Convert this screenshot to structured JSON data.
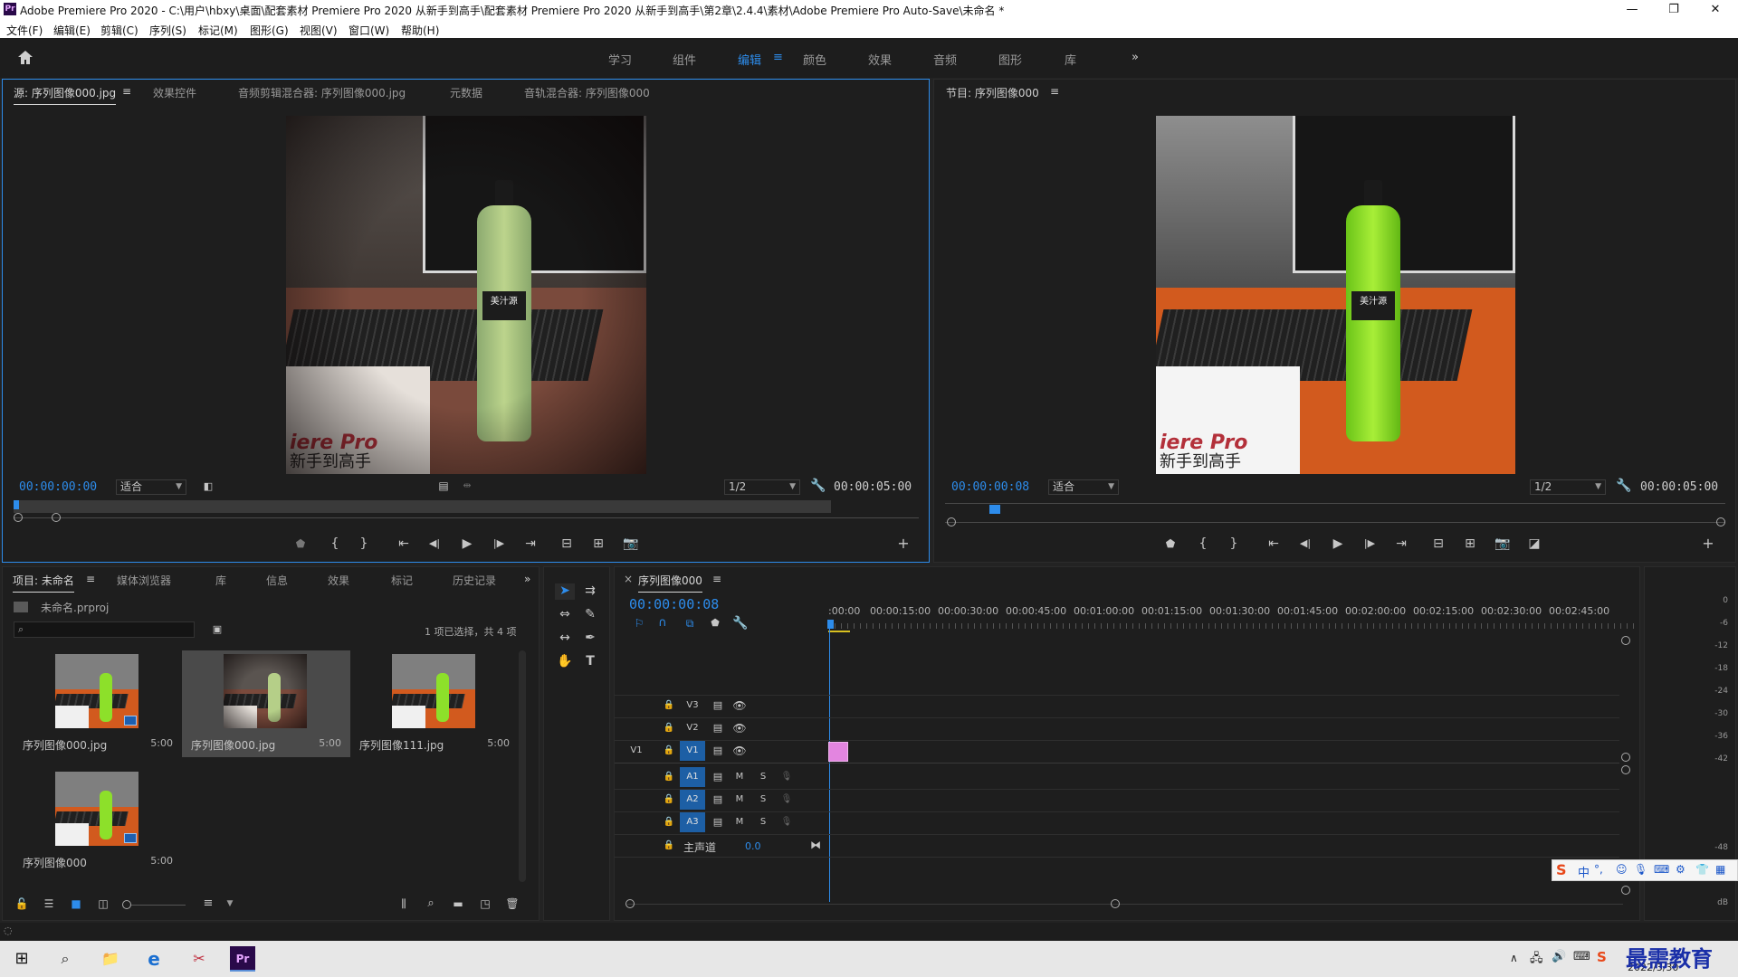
{
  "titlebar": {
    "logo": "Pr",
    "title": "Adobe Premiere Pro 2020 - C:\\用户\\hbxy\\桌面\\配套素材 Premiere Pro 2020 从新手到高手\\配套素材 Premiere Pro 2020 从新手到高手\\第2章\\2.4.4\\素材\\Adobe Premiere Pro Auto-Save\\未命名 *",
    "minimize": "—",
    "maximize": "❐",
    "close": "✕"
  },
  "menubar": [
    "文件(F)",
    "编辑(E)",
    "剪辑(C)",
    "序列(S)",
    "标记(M)",
    "图形(G)",
    "视图(V)",
    "窗口(W)",
    "帮助(H)"
  ],
  "workspaces": {
    "tabs": [
      "学习",
      "组件",
      "编辑",
      "颜色",
      "效果",
      "音频",
      "图形",
      "库"
    ],
    "active": "编辑",
    "more": "»"
  },
  "source_panel": {
    "tabs": [
      "源: 序列图像000.jpg",
      "效果控件",
      "音频剪辑混合器: 序列图像000.jpg",
      "元数据",
      "音轨混合器: 序列图像000"
    ],
    "timecode": "00:00:00:00",
    "fit": "适合",
    "resolution": "1/2",
    "duration": "00:00:05:00"
  },
  "program_panel": {
    "title": "节目: 序列图像000",
    "timecode": "00:00:00:08",
    "fit": "适合",
    "resolution": "1/2",
    "duration": "00:00:05:00"
  },
  "frame": {
    "book_title": "iere Pro",
    "book_sub": "新手到高手",
    "bottle_label": "美汁源"
  },
  "project_panel": {
    "tabs": [
      "项目: 未命名",
      "媒体浏览器",
      "库",
      "信息",
      "效果",
      "标记",
      "历史记录"
    ],
    "project_file": "未命名.prproj",
    "selection_status": "1 项已选择，共 4 项",
    "search_placeholder": "",
    "items": [
      {
        "name": "序列图像000.jpg",
        "duration": "5:00"
      },
      {
        "name": "序列图像000.jpg",
        "duration": "5:00"
      },
      {
        "name": "序列图像111.jpg",
        "duration": "5:00"
      },
      {
        "name": "序列图像000",
        "duration": "5:00"
      }
    ]
  },
  "timeline": {
    "title": "序列图像000",
    "timecode": "00:00:00:08",
    "ruler": [
      ":00:00",
      "00:00:15:00",
      "00:00:30:00",
      "00:00:45:00",
      "00:01:00:00",
      "00:01:15:00",
      "00:01:30:00",
      "00:01:45:00",
      "00:02:00:00",
      "00:02:15:00",
      "00:02:30:00",
      "00:02:45:00"
    ],
    "video_tracks": [
      "V3",
      "V2",
      "V1"
    ],
    "source_patch": "V1",
    "audio_tracks": [
      "A1",
      "A2",
      "A3"
    ],
    "mute": "M",
    "solo": "S",
    "master": "主声道",
    "master_value": "0.0"
  },
  "meters": [
    "0",
    "-6",
    "-12",
    "-18",
    "-24",
    "-30",
    "-36",
    "-42",
    "-48",
    "dB"
  ],
  "ime_bar": {
    "logo": "S",
    "lang": "中",
    "punct": "°,"
  },
  "taskbar": {
    "date": "2022/3/30",
    "watermark": "最需教育"
  },
  "colors": {
    "accent": "#2d8ceb",
    "panel_bg": "#1e1e1e",
    "clip": "#e385e0"
  }
}
